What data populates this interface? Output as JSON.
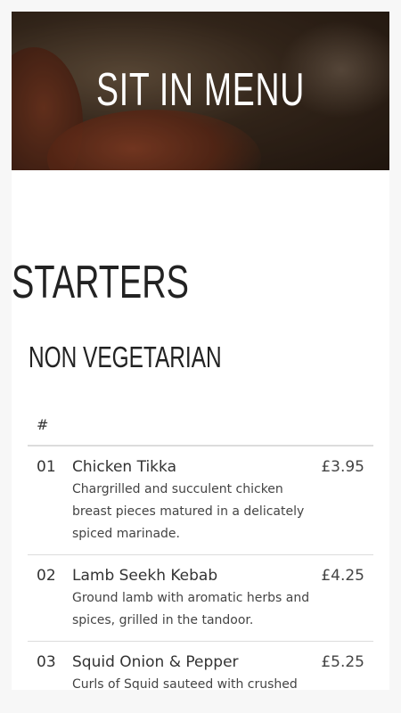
{
  "hero": {
    "title": "SIT IN MENU"
  },
  "section": {
    "title": "STARTERS",
    "subtitle": "NON VEGETARIAN"
  },
  "table": {
    "header_number": "#",
    "rows": [
      {
        "number": "01",
        "name": "Chicken Tikka",
        "description": "Chargrilled and succulent chicken breast pieces matured in a delicately spiced marinade.",
        "price": "£3.95"
      },
      {
        "number": "02",
        "name": "Lamb Seekh Kebab",
        "description": "Ground lamb with aromatic herbs and spices, grilled in the tandoor.",
        "price": "£4.25"
      },
      {
        "number": "03",
        "name": "Squid Onion & Pepper",
        "description": "Curls of Squid sauteed with crushed",
        "price": "£5.25"
      }
    ]
  }
}
